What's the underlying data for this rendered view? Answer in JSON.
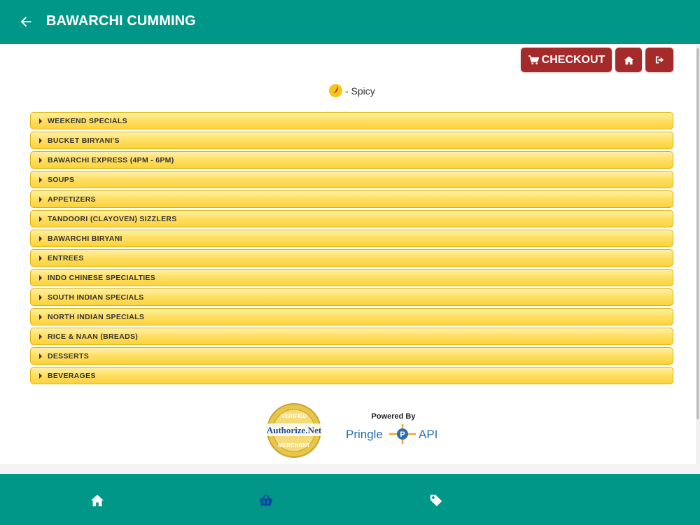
{
  "header": {
    "title": "BAWARCHI CUMMING",
    "back_icon": "arrow-left-icon"
  },
  "actions": {
    "checkout_label": "CHECKOUT",
    "checkout_icon": "shopping-cart-icon",
    "home_icon": "home-icon",
    "logout_icon": "sign-out-icon",
    "button_color": "#a52a2a"
  },
  "legend": {
    "spicy_text": "- Spicy",
    "icon": "chili-pepper-icon"
  },
  "menu": {
    "categories": [
      "WEEKEND SPECIALS",
      "BUCKET BIRYANI'S",
      "BAWARCHI EXPRESS (4PM - 6PM)",
      "SOUPS",
      "APPETIZERS",
      "TANDOORI (CLAYOVEN) SIZZLERS",
      "BAWARCHI BIRYANI",
      "ENTREES",
      "INDO CHINESE SPECIALTIES",
      "SOUTH INDIAN SPECIALS",
      "NORTH INDIAN SPECIALS",
      "RICE & NAAN (BREADS)",
      "DESSERTS",
      "BEVERAGES"
    ]
  },
  "badges": {
    "authorize_top": "VERIFIED",
    "authorize_name": "Authorize.Net",
    "authorize_bottom": "MERCHANT",
    "powered_by": "Powered By",
    "pringle_left": "Pringle",
    "pringle_mid": "P",
    "pringle_right": "API"
  },
  "footer": {
    "nav": [
      {
        "icon": "home-icon",
        "active": false
      },
      {
        "icon": "shopping-basket-icon",
        "active": true
      },
      {
        "icon": "tag-icon",
        "active": false
      }
    ]
  },
  "colors": {
    "primary": "#009688",
    "menu_gold": "#fcd23c",
    "active_nav": "#0d47a1"
  }
}
